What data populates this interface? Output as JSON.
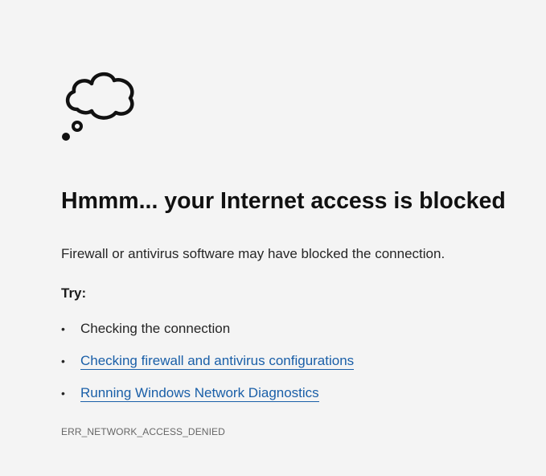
{
  "icon": "thought-cloud-icon",
  "title": "Hmmm... your Internet access is blocked",
  "description": "Firewall or antivirus software may have blocked the connection.",
  "try_label": "Try:",
  "suggestions": [
    {
      "text": "Checking the connection",
      "link": false
    },
    {
      "text": "Checking firewall and antivirus configurations",
      "link": true
    },
    {
      "text": "Running Windows Network Diagnostics",
      "link": true
    }
  ],
  "bullet": "•",
  "error_code": "ERR_NETWORK_ACCESS_DENIED",
  "colors": {
    "background": "#f4f4f4",
    "link": "#1a5fa8",
    "text": "#1b1b1b",
    "muted": "#666666"
  }
}
